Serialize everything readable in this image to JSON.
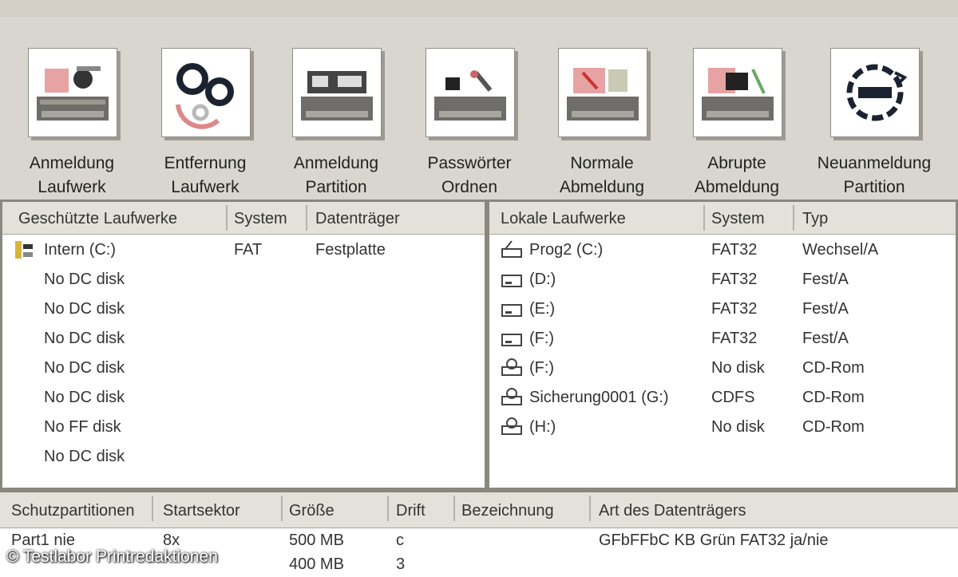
{
  "toolbar": {
    "buttons": [
      {
        "label_line1": "Anmeldung",
        "label_line2": "Laufwerk",
        "icon": "drive-register-icon"
      },
      {
        "label_line1": "Entfernung",
        "label_line2": "Laufwerk",
        "icon": "gears-icon"
      },
      {
        "label_line1": "Anmeldung",
        "label_line2": "Partition",
        "icon": "partition-register-icon"
      },
      {
        "label_line1": "Passwörter",
        "label_line2": "Ordnen",
        "icon": "password-icon"
      },
      {
        "label_line1": "Normale",
        "label_line2": "Abmeldung",
        "icon": "normal-logoff-icon"
      },
      {
        "label_line1": "Abrupte",
        "label_line2": "Abmeldung",
        "icon": "abrupt-logoff-icon"
      },
      {
        "label_line1": "Neuanmeldung",
        "label_line2": "Partition",
        "icon": "reconnect-icon"
      }
    ]
  },
  "left_pane": {
    "headers": [
      "Geschützte Laufwerke",
      "System",
      "Datenträger"
    ],
    "rows": [
      {
        "name": "Intern (C:)",
        "system": "FAT",
        "medium": "Festplatte"
      },
      {
        "name": "No DC disk",
        "system": "",
        "medium": ""
      },
      {
        "name": "No DC disk",
        "system": "",
        "medium": ""
      },
      {
        "name": "No DC disk",
        "system": "",
        "medium": ""
      },
      {
        "name": "No DC disk",
        "system": "",
        "medium": ""
      },
      {
        "name": "No DC disk",
        "system": "",
        "medium": ""
      },
      {
        "name": "No FF disk",
        "system": "",
        "medium": ""
      },
      {
        "name": "No DC disk",
        "system": "",
        "medium": ""
      }
    ]
  },
  "right_pane": {
    "headers": [
      "Lokale Laufwerke",
      "System",
      "Typ"
    ],
    "rows": [
      {
        "name": "Prog2 (C:)",
        "system": "FAT32",
        "type": "Wechsel/A",
        "icon": "drive-icon"
      },
      {
        "name": "(D:)",
        "system": "FAT32",
        "type": "Fest/A",
        "icon": "drive-icon"
      },
      {
        "name": "(E:)",
        "system": "FAT32",
        "type": "Fest/A",
        "icon": "drive-icon"
      },
      {
        "name": "(F:)",
        "system": "FAT32",
        "type": "Fest/A",
        "icon": "drive-icon"
      },
      {
        "name": "(F:)",
        "system": "No disk",
        "type": "CD-Rom",
        "icon": "cd-drive-icon"
      },
      {
        "name": "Sicherung0001 (G:)",
        "system": "CDFS",
        "type": "CD-Rom",
        "icon": "cd-drive-icon"
      },
      {
        "name": "(H:)",
        "system": "No disk",
        "type": "CD-Rom",
        "icon": "cd-drive-icon"
      }
    ]
  },
  "bottom_pane": {
    "headers": [
      "Schutzpartitionen",
      "Startsektor",
      "Größe",
      "Drift",
      "Bezeichnung",
      "Art des Datenträgers"
    ],
    "rows": [
      {
        "c1": "Part1 nie",
        "c2": "8x",
        "c3": "500 MB",
        "c4": "c",
        "c5": "",
        "c6": "GFbFFbC KB  Grün FAT32  ja/nie"
      },
      {
        "c1": "",
        "c2": "",
        "c3": "400 MB",
        "c4": "3",
        "c5": "",
        "c6": ""
      }
    ]
  },
  "copyright": "© Testlabor Printredaktionen"
}
